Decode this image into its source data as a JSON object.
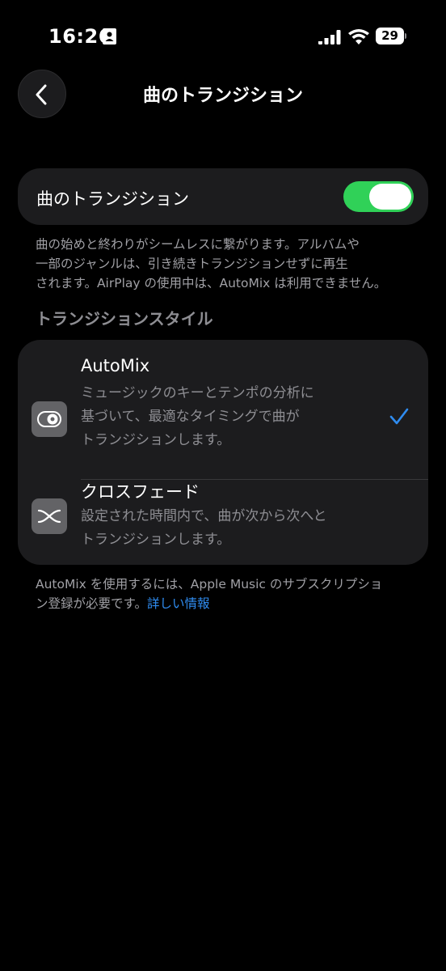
{
  "status_bar": {
    "time": "16:26",
    "battery_level": "29",
    "icons": [
      "contact-card-icon",
      "cellular-signal-icon",
      "wifi-icon",
      "battery-icon"
    ]
  },
  "nav": {
    "title": "曲のトランジション",
    "back_icon": "chevron-left-icon"
  },
  "transition_toggle": {
    "label": "曲のトランジション",
    "enabled": true,
    "on_color": "#30d158"
  },
  "transition_footnote": {
    "line1": "曲の始めと終わりがシームレスに繋がります。アルバムや",
    "line2": "一部のジャンルは、引き続きトランジションせずに再生",
    "line3": "されます。AirPlay の使用中は、AutoMix は利用できません。"
  },
  "style_section": {
    "header": "トランジションスタイル",
    "options": [
      {
        "title": "AutoMix",
        "desc_line1": "ミュージックのキーとテンポの分析に",
        "desc_line2": "基づいて、最適なタイミングで曲が",
        "desc_line3": "トランジションします。",
        "icon": "automix-icon",
        "selected": true
      },
      {
        "title": "クロスフェード",
        "desc_line1": "設定された時間内で、曲が次から次へと",
        "desc_line2": "トランジションします。",
        "icon": "crossfade-icon",
        "selected": false
      }
    ],
    "check_color": "#2f8cf0"
  },
  "subscription_footnote": {
    "line1": "AutoMix を使用するには、Apple Music のサブスクリプショ",
    "line2_text": "ン登録が必要です。",
    "link_text": "詳しい情報",
    "link_color": "#2f8cf0"
  }
}
